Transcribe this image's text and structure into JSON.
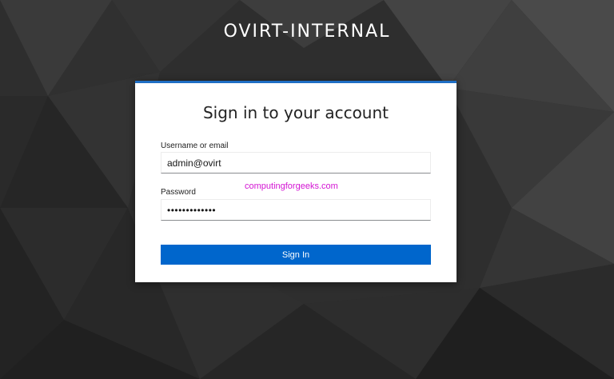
{
  "realm": {
    "title": "OVIRT-INTERNAL"
  },
  "login": {
    "heading": "Sign in to your account",
    "username_label": "Username or email",
    "username_value": "admin@ovirt",
    "password_label": "Password",
    "password_value": "•••••••••••••",
    "watermark": "computingforgeeks.com",
    "submit_label": "Sign In"
  },
  "colors": {
    "accent": "#0066cc",
    "card_border": "#1f6fc5",
    "watermark": "#d314d3",
    "background": "#2b2b2b"
  }
}
